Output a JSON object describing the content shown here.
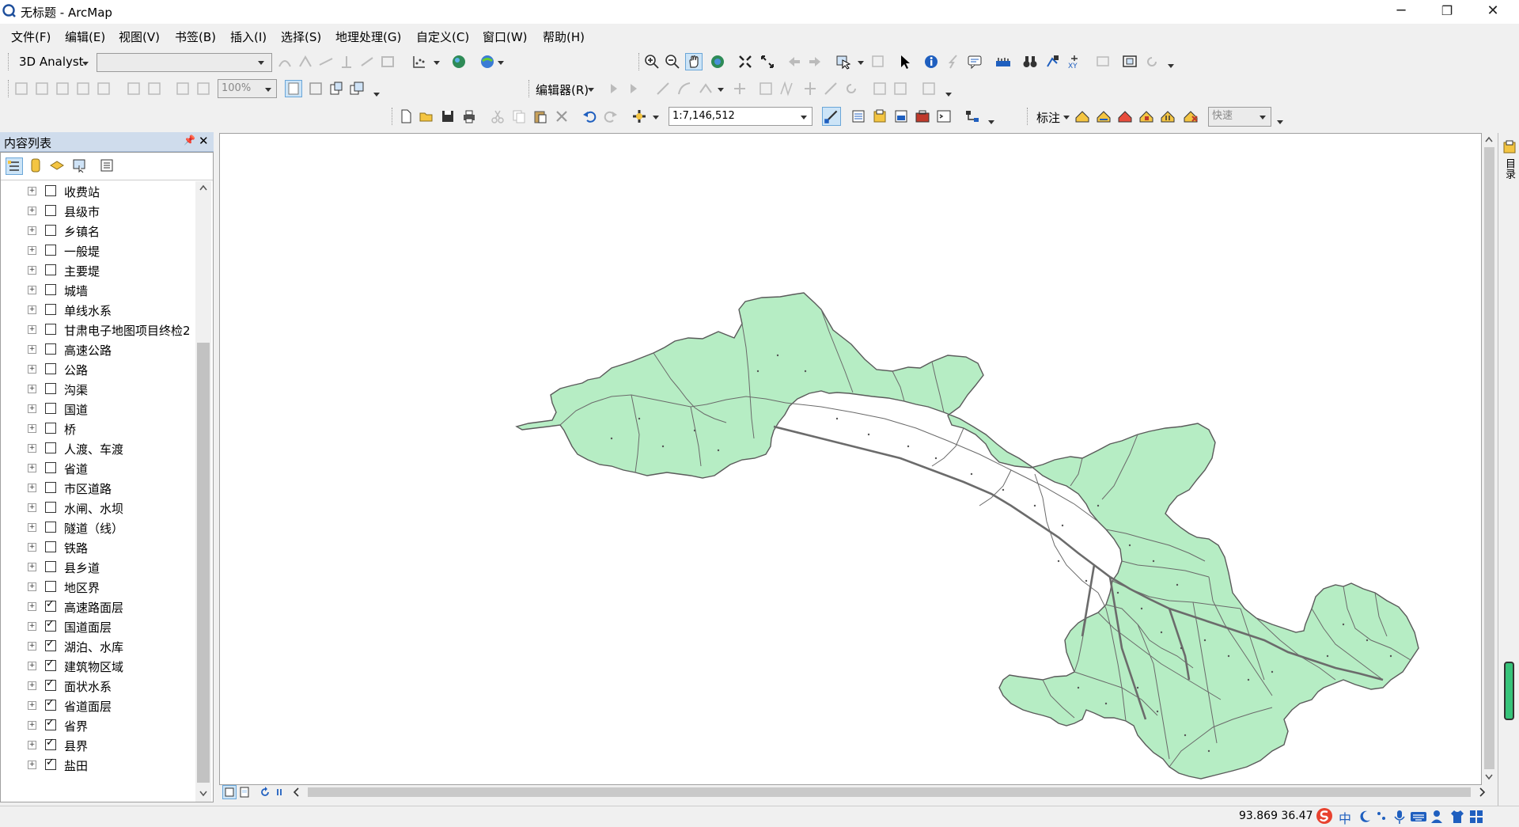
{
  "window": {
    "title": "无标题 - ArcMap",
    "minimize": "─",
    "maximize": "❐",
    "close": "✕"
  },
  "menu": [
    "文件(F)",
    "编辑(E)",
    "视图(V)",
    "书签(B)",
    "插入(I)",
    "选择(S)",
    "地理处理(G)",
    "自定义(C)",
    "窗口(W)",
    "帮助(H)"
  ],
  "toolbars": {
    "analyst_label": "3D Analyst",
    "zoom_value": "100%",
    "editor_label": "编辑器(R)",
    "scale_value": "1:7,146,512",
    "label_menu": "标注",
    "speed_value": "快速"
  },
  "toc": {
    "title": "内容列表",
    "pin": "📌",
    "close": "✕",
    "layers": [
      {
        "name": "收费站",
        "checked": false
      },
      {
        "name": "县级市",
        "checked": false
      },
      {
        "name": "乡镇名",
        "checked": false
      },
      {
        "name": "一般堤",
        "checked": false
      },
      {
        "name": "主要堤",
        "checked": false
      },
      {
        "name": "城墙",
        "checked": false
      },
      {
        "name": "单线水系",
        "checked": false
      },
      {
        "name": "甘肃电子地图项目终检2",
        "checked": false
      },
      {
        "name": "高速公路",
        "checked": false
      },
      {
        "name": "公路",
        "checked": false
      },
      {
        "name": "沟渠",
        "checked": false
      },
      {
        "name": "国道",
        "checked": false
      },
      {
        "name": "桥",
        "checked": false
      },
      {
        "name": "人渡、车渡",
        "checked": false
      },
      {
        "name": "省道",
        "checked": false
      },
      {
        "name": "市区道路",
        "checked": false
      },
      {
        "name": "水闸、水坝",
        "checked": false
      },
      {
        "name": "隧道（线）",
        "checked": false
      },
      {
        "name": "铁路",
        "checked": false
      },
      {
        "name": "县乡道",
        "checked": false
      },
      {
        "name": "地区界",
        "checked": false
      },
      {
        "name": "高速路面层",
        "checked": true
      },
      {
        "name": "国道面层",
        "checked": true
      },
      {
        "name": "湖泊、水库",
        "checked": true
      },
      {
        "name": "建筑物区域",
        "checked": true
      },
      {
        "name": "面状水系",
        "checked": true
      },
      {
        "name": "省道面层",
        "checked": true
      },
      {
        "name": "省界",
        "checked": true
      },
      {
        "name": "县界",
        "checked": true
      },
      {
        "name": "盐田",
        "checked": true
      }
    ]
  },
  "right_dock_label": "目录",
  "status": {
    "coords": "93.869  36.47"
  },
  "colors": {
    "map_fill": "#b6edc4",
    "map_line": "#5a5a5a",
    "panel_header": "#cfdcec"
  }
}
